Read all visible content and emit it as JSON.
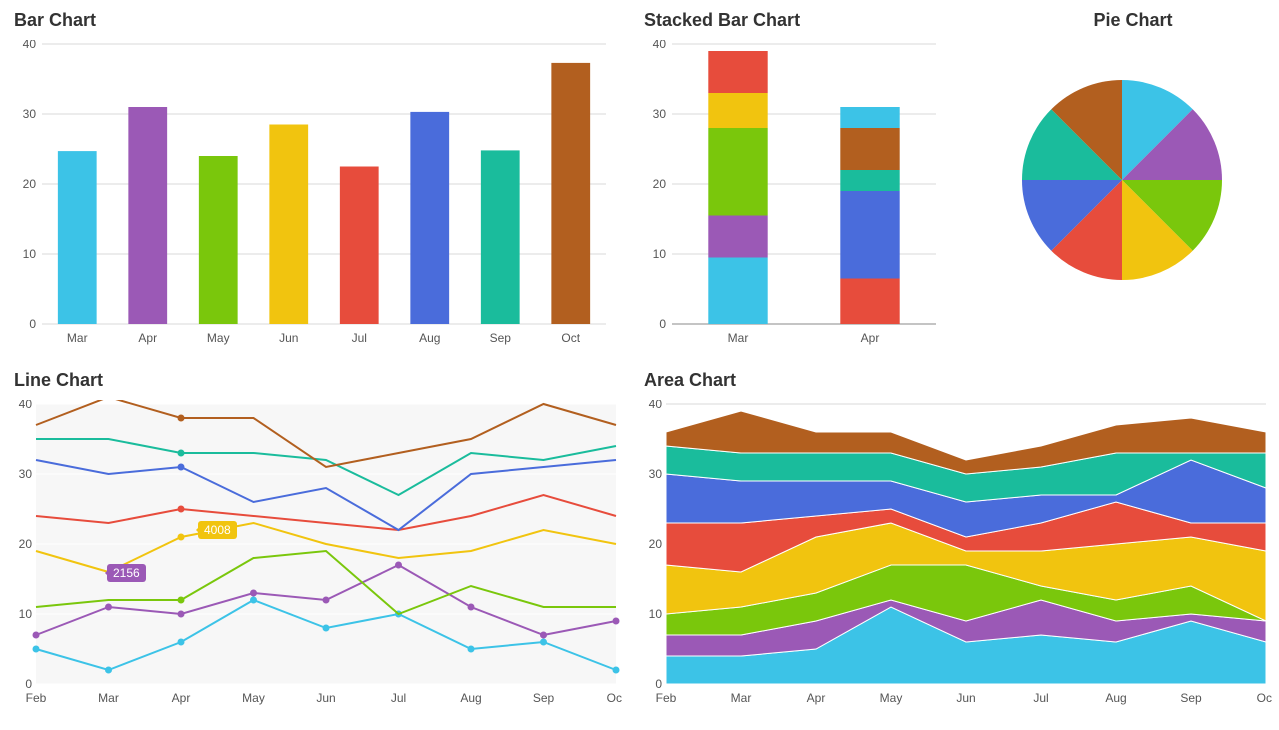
{
  "titles": {
    "bar": "Bar Chart",
    "stacked": "Stacked Bar Chart",
    "pie": "Pie Chart",
    "line": "Line Chart",
    "area": "Area Chart"
  },
  "palette": [
    "#3cc3e7",
    "#9b59b6",
    "#7ac70c",
    "#f1c40f",
    "#e74c3c",
    "#4a6cdb",
    "#1abc9c",
    "#b25f1f"
  ],
  "tooltips": {
    "purple": "2156",
    "yellow": "4008"
  },
  "chart_data": [
    {
      "id": "bar",
      "type": "bar",
      "title": "Bar Chart",
      "xlabel": "",
      "ylabel": "",
      "ylim": [
        0,
        40
      ],
      "yticks": [
        0,
        10,
        20,
        30,
        40
      ],
      "categories": [
        "Mar",
        "Apr",
        "May",
        "Jun",
        "Jul",
        "Aug",
        "Sep",
        "Oct"
      ],
      "values": [
        24.7,
        31.0,
        24.0,
        28.5,
        22.5,
        30.3,
        24.8,
        37.3
      ]
    },
    {
      "id": "stacked",
      "type": "bar-stacked",
      "title": "Stacked Bar Chart",
      "xlabel": "",
      "ylabel": "",
      "ylim": [
        0,
        40
      ],
      "yticks": [
        0,
        10,
        20,
        30,
        40
      ],
      "categories": [
        "Mar",
        "Apr"
      ],
      "series": [
        {
          "name": "cyan",
          "values": [
            9.5,
            3.0
          ]
        },
        {
          "name": "purple",
          "values": [
            6.0,
            0.0
          ]
        },
        {
          "name": "green",
          "values": [
            12.5,
            8.0
          ]
        },
        {
          "name": "yellow",
          "values": [
            5.0,
            0.0
          ]
        },
        {
          "name": "red",
          "values": [
            6.0,
            6.5
          ]
        },
        {
          "name": "blue",
          "values": [
            0.0,
            12.5
          ]
        },
        {
          "name": "teal",
          "values": [
            0.0,
            3.0
          ]
        },
        {
          "name": "brown",
          "values": [
            0.0,
            6.0
          ]
        }
      ],
      "_note": "series listed bottom-to-top; second column uses: cyan(top), brown, teal, blue, red, yellow bottom-to-top visually"
    },
    {
      "id": "pie",
      "type": "pie",
      "title": "Pie Chart",
      "categories": [
        "cyan",
        "purple",
        "green",
        "yellow",
        "red",
        "blue",
        "teal",
        "brown"
      ],
      "values": [
        12.5,
        12.5,
        12.5,
        12.5,
        12.5,
        12.5,
        12.5,
        12.5
      ]
    },
    {
      "id": "line",
      "type": "line",
      "title": "Line Chart",
      "xlabel": "",
      "ylabel": "",
      "ylim": [
        0,
        40
      ],
      "yticks": [
        0,
        10,
        20,
        30,
        40
      ],
      "x": [
        "Feb",
        "Mar",
        "Apr",
        "May",
        "Jun",
        "Jul",
        "Aug",
        "Sep",
        "Oct"
      ],
      "series": [
        {
          "name": "cyan",
          "values": [
            5,
            2,
            6,
            12,
            8,
            10,
            5,
            6,
            2
          ]
        },
        {
          "name": "purple",
          "values": [
            7,
            11,
            10,
            13,
            12,
            17,
            11,
            7,
            9
          ]
        },
        {
          "name": "green",
          "values": [
            11,
            12,
            12,
            18,
            19,
            10,
            14,
            11,
            11
          ]
        },
        {
          "name": "yellow",
          "values": [
            19,
            16,
            21,
            23,
            20,
            18,
            19,
            22,
            20
          ]
        },
        {
          "name": "red",
          "values": [
            24,
            23,
            25,
            24,
            23,
            22,
            24,
            27,
            24
          ]
        },
        {
          "name": "blue",
          "values": [
            32,
            30,
            31,
            26,
            28,
            22,
            30,
            31,
            32
          ]
        },
        {
          "name": "teal",
          "values": [
            35,
            35,
            33,
            33,
            32,
            27,
            33,
            32,
            34
          ]
        },
        {
          "name": "brown",
          "values": [
            37,
            41,
            38,
            38,
            31,
            33,
            35,
            40,
            37
          ]
        }
      ],
      "markers_series_index": [
        0,
        1
      ],
      "annotations": [
        {
          "series": "purple",
          "x": "Mar",
          "label": "2156"
        },
        {
          "series": "yellow",
          "x": "Apr",
          "label": "4008"
        }
      ]
    },
    {
      "id": "area",
      "type": "area-stacked",
      "title": "Area Chart",
      "xlabel": "",
      "ylabel": "",
      "ylim": [
        0,
        40
      ],
      "yticks": [
        0,
        10,
        20,
        30,
        40
      ],
      "x": [
        "Feb",
        "Mar",
        "Apr",
        "May",
        "Jun",
        "Jul",
        "Aug",
        "Sep",
        "Oct"
      ],
      "series": [
        {
          "name": "cyan",
          "values": [
            4,
            4,
            5,
            11,
            6,
            7,
            6,
            9,
            6
          ]
        },
        {
          "name": "purple",
          "values": [
            3,
            3,
            4,
            1,
            3,
            5,
            3,
            1,
            3
          ]
        },
        {
          "name": "green",
          "values": [
            3,
            4,
            4,
            5,
            8,
            2,
            3,
            4,
            0
          ]
        },
        {
          "name": "yellow",
          "values": [
            7,
            5,
            8,
            6,
            2,
            5,
            8,
            7,
            10
          ]
        },
        {
          "name": "red",
          "values": [
            6,
            7,
            3,
            2,
            2,
            4,
            6,
            2,
            4
          ]
        },
        {
          "name": "blue",
          "values": [
            7,
            6,
            5,
            4,
            5,
            4,
            1,
            9,
            5
          ]
        },
        {
          "name": "teal",
          "values": [
            4,
            4,
            4,
            4,
            4,
            4,
            6,
            1,
            5
          ]
        },
        {
          "name": "brown",
          "values": [
            2,
            6,
            3,
            3,
            2,
            3,
            4,
            5,
            3
          ]
        }
      ]
    }
  ]
}
